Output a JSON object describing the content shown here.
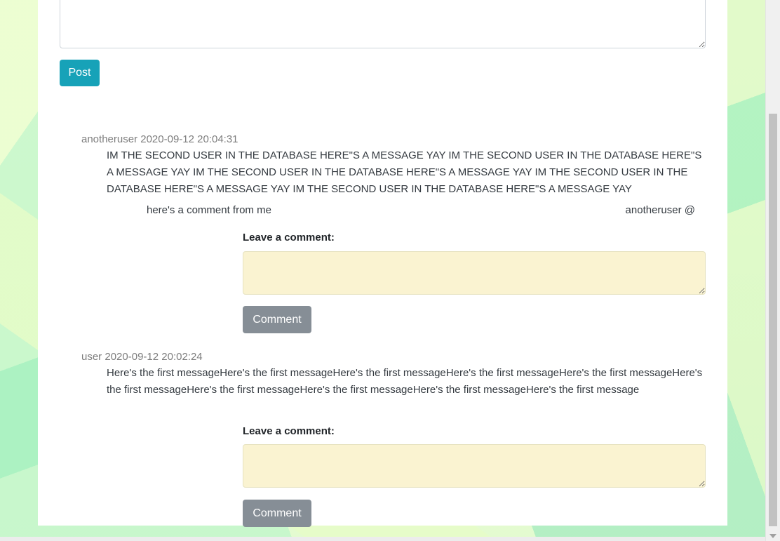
{
  "post_form": {
    "textarea_value": "",
    "post_label": "Post"
  },
  "messages": [
    {
      "author": "anotheruser",
      "timestamp": "2020-09-12 20:04:31",
      "body": "IM THE SECOND USER IN THE DATABASE HERE\"S A MESSAGE YAY IM THE SECOND USER IN THE DATABASE HERE\"S A MESSAGE YAY IM THE SECOND USER IN THE DATABASE HERE\"S A MESSAGE YAY IM THE SECOND USER IN THE DATABASE HERE\"S A MESSAGE YAY IM THE SECOND USER IN THE DATABASE HERE\"S A MESSAGE YAY",
      "comments": [
        {
          "text": "here's a comment from me",
          "author": "anotheruser @"
        }
      ],
      "comment_form": {
        "label": "Leave a comment:",
        "button_label": "Comment"
      }
    },
    {
      "author": "user",
      "timestamp": "2020-09-12 20:02:24",
      "body": "Here's the first messageHere's the first messageHere's the first messageHere's the first messageHere's the first messageHere's the first messageHere's the first messageHere's the first messageHere's the first messageHere's the first message",
      "comments": [],
      "comment_form": {
        "label": "Leave a comment:",
        "button_label": "Comment"
      }
    }
  ],
  "colors": {
    "post_button": "#17a2b8",
    "comment_button": "#868e96",
    "comment_field_bg": "#faf3d1",
    "meta_text": "#7d7d7d"
  }
}
